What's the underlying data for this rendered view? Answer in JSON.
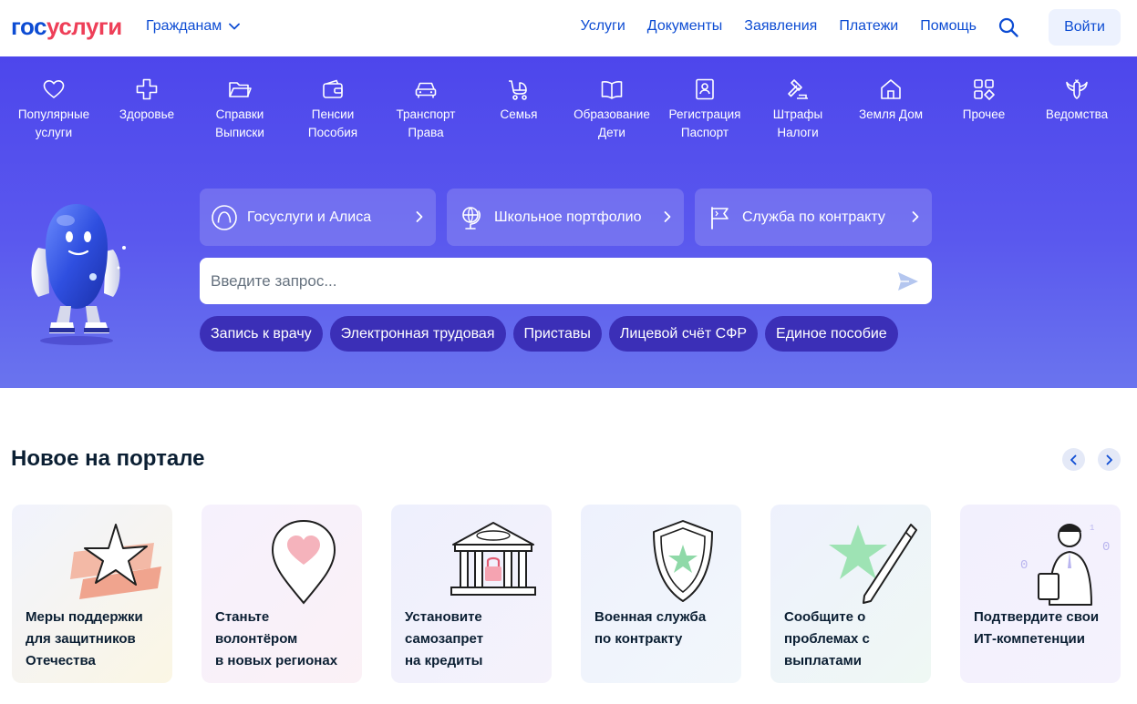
{
  "header": {
    "logo_part1": "гос",
    "logo_part2": "услуги",
    "audience": "Гражданам",
    "nav": [
      "Услуги",
      "Документы",
      "Заявления",
      "Платежи",
      "Помощь"
    ],
    "login": "Войти"
  },
  "categories": [
    {
      "label": "Популярные\nуслуги",
      "icon": "heart-icon"
    },
    {
      "label": "Здоровье",
      "icon": "medical-cross-icon"
    },
    {
      "label": "Справки\nВыписки",
      "icon": "folder-icon"
    },
    {
      "label": "Пенсии\nПособия",
      "icon": "wallet-icon"
    },
    {
      "label": "Транспорт\nПрава",
      "icon": "car-icon"
    },
    {
      "label": "Семья",
      "icon": "stroller-icon"
    },
    {
      "label": "Образование\nДети",
      "icon": "book-icon"
    },
    {
      "label": "Регистрация\nПаспорт",
      "icon": "passport-icon"
    },
    {
      "label": "Штрафы\nНалоги",
      "icon": "gavel-icon"
    },
    {
      "label": "Земля Дом",
      "icon": "house-icon"
    },
    {
      "label": "Прочее",
      "icon": "grid-icon"
    },
    {
      "label": "Ведомства",
      "icon": "eagle-icon"
    }
  ],
  "quick_links": [
    {
      "label": "Госуслуги и Алиса",
      "icon": "alice-icon"
    },
    {
      "label": "Школьное портфолио",
      "icon": "globe-icon"
    },
    {
      "label": "Служба по контракту",
      "icon": "flag-icon"
    }
  ],
  "search": {
    "placeholder": "Введите запрос..."
  },
  "chips": [
    "Запись к врачу",
    "Электронная трудовая",
    "Приставы",
    "Лицевой счёт СФР",
    "Единое пособие"
  ],
  "news": {
    "title": "Новое на портале",
    "cards": [
      {
        "text": "Меры поддержки\nдля защитников\nОтечества",
        "icon": "star-ribbon-icon"
      },
      {
        "text": "Станьте\nволонтёром\nв новых регионах",
        "icon": "heart-pin-icon"
      },
      {
        "text": "Установите\nсамозапрет\nна кредиты",
        "icon": "bank-lock-icon"
      },
      {
        "text": "Военная служба\nпо контракту",
        "icon": "shield-star-icon"
      },
      {
        "text": "Сообщите о\nпроблемах с\nвыплатами",
        "icon": "star-pen-icon"
      },
      {
        "text": "Подтвердите свои\nИТ-компетенции",
        "icon": "it-specialist-icon"
      }
    ]
  },
  "colors": {
    "brand_blue": "#0d4cd3",
    "brand_red": "#ee3f58",
    "hero_bg": "#4d46ec",
    "chip_bg": "#3b2fb7"
  }
}
